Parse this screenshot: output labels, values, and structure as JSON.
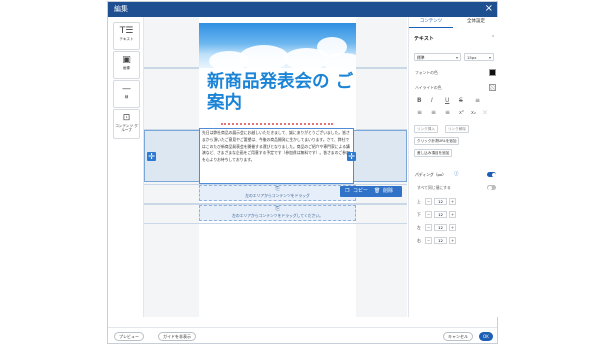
{
  "colors": {
    "titlebar": "#1d4f91",
    "accent": "#1d5fb4",
    "heading": "#1b84d6"
  },
  "window": {
    "title": "編集",
    "close_icon": "close-icon"
  },
  "tools": [
    {
      "icon": "text-icon",
      "glyph": "T☰",
      "label": "テキスト"
    },
    {
      "icon": "image-icon",
      "glyph": "▣",
      "label": "画像"
    },
    {
      "icon": "divider-icon",
      "glyph": "—",
      "label": "線"
    },
    {
      "icon": "content-group-icon",
      "glyph": "⊡",
      "label": "コンテンツ グループ"
    }
  ],
  "canvas": {
    "heading": "新商品発表会の ご案内",
    "body_text": "先日は弊社商品の展示会にお越しいただきまして、誠にありがとうございました。皆さまから頂いたご意見やご要望は、今後の商品開発に生かしてまいります。さて、弊社ではこのたび新商品発表会を開催する運びとなりました。商品のご紹介や専門家による講演など、さまざまな企画をご用意する予定です（参加費は無料です）。皆さまのご参加を心よりお待ちしております。",
    "drop_hint_1": "左のエリアからコンテンツをドラッグ",
    "drop_hint_2": "左のエリアからコンテンツをドラッグしてください。",
    "copy_label": "コピー",
    "delete_label": "削除"
  },
  "panel": {
    "tabs": [
      "コンテンツ",
      "全体設定"
    ],
    "section_title": "テキスト",
    "style_value": "標準",
    "size_value": "15px",
    "font_color_label": "フォントの色",
    "font_color": "#111111",
    "highlight_label": "ハイライトの色",
    "format_buttons": [
      "B",
      "I",
      "U",
      "S",
      "≡",
      "≡",
      "≡",
      "≡",
      "x²",
      "x₂",
      "⤫"
    ],
    "link_insert": "リンク挿入",
    "link_remove": "リンク解除",
    "click_url_insert": "クリック計測URLを追加",
    "variable_insert": "差し込み項目を追加",
    "padding_label": "パディング（px）",
    "padding_toggle_on": true,
    "same_all_label": "すべて同じ値にする",
    "same_all_on": false,
    "padding_rows": [
      {
        "label": "上",
        "value": "12"
      },
      {
        "label": "下",
        "value": "12"
      },
      {
        "label": "左",
        "value": "12"
      },
      {
        "label": "右",
        "value": "12"
      }
    ]
  },
  "footer": {
    "preview": "プレビュー",
    "guide": "ガイドを非表示",
    "cancel": "キャンセル",
    "ok": "OK"
  }
}
